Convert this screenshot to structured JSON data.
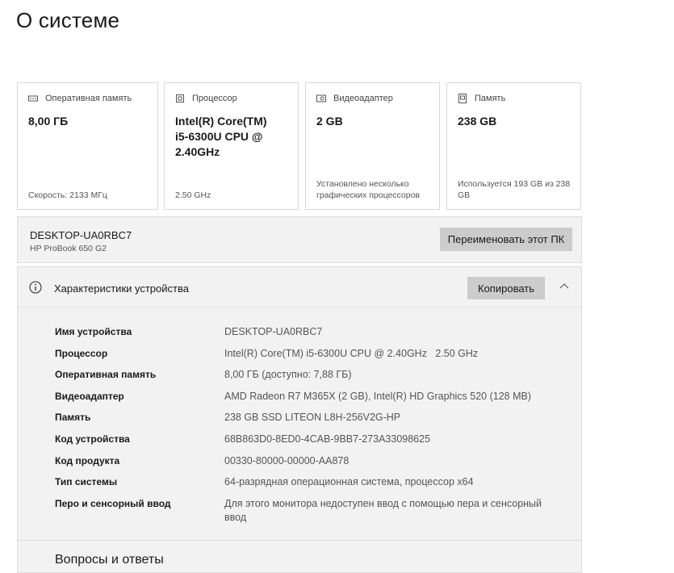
{
  "page": {
    "title": "О системе"
  },
  "cards": [
    {
      "icon": "ram-icon",
      "label": "Оперативная память",
      "value": "8,00 ГБ",
      "foot": "Скорость: 2133 МГц"
    },
    {
      "icon": "cpu-icon",
      "label": "Процессор",
      "value": "Intel(R) Core(TM) i5-6300U CPU @ 2.40GHz",
      "foot": "2.50 GHz"
    },
    {
      "icon": "gpu-icon",
      "label": "Видеоадаптер",
      "value": "2 GB",
      "foot": "Установлено несколько графических процессоров"
    },
    {
      "icon": "storage-icon",
      "label": "Память",
      "value": "238 GB",
      "foot": "Используется 193 GB из 238 GB"
    }
  ],
  "pc": {
    "name": "DESKTOP-UA0RBC7",
    "model": "HP ProBook 650 G2",
    "rename_label": "Переименовать этот ПК"
  },
  "specs": {
    "title": "Характеристики устройства",
    "copy_label": "Копировать",
    "rows": [
      {
        "key": "Имя устройства",
        "value": "DESKTOP-UA0RBC7"
      },
      {
        "key": "Процессор",
        "value": "Intel(R) Core(TM) i5-6300U CPU @ 2.40GHz   2.50 GHz"
      },
      {
        "key": "Оперативная память",
        "value": "8,00 ГБ (доступно: 7,88 ГБ)"
      },
      {
        "key": "Видеоадаптер",
        "value": "AMD Radeon R7 M365X (2 GB), Intel(R) HD Graphics 520 (128 MB)"
      },
      {
        "key": "Память",
        "value": "238 GB SSD LITEON L8H-256V2G-HP"
      },
      {
        "key": "Код устройства",
        "value": "68B863D0-8ED0-4CAB-9BB7-273A33098625"
      },
      {
        "key": "Код продукта",
        "value": "00330-80000-00000-AA878"
      },
      {
        "key": "Тип системы",
        "value": "64-разрядная операционная система, процессор x64"
      },
      {
        "key": "Перо и сенсорный ввод",
        "value": "Для этого монитора недоступен ввод с помощью пера и сенсорный ввод"
      }
    ]
  },
  "faq": {
    "title": "Вопросы и ответы"
  }
}
